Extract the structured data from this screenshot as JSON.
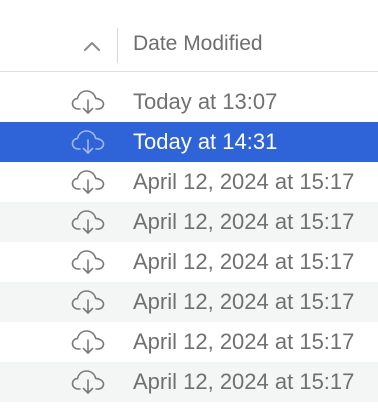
{
  "column": {
    "title": "Date Modified",
    "sort_icon": "chevron-up-icon"
  },
  "rows": [
    {
      "date": "Today at 13:07",
      "icon": "cloud-download-icon",
      "selected": false
    },
    {
      "date": "Today at 14:31",
      "icon": "cloud-download-icon",
      "selected": true
    },
    {
      "date": "April 12, 2024 at 15:17",
      "icon": "cloud-download-icon",
      "selected": false
    },
    {
      "date": "April 12, 2024 at 15:17",
      "icon": "cloud-download-icon",
      "selected": false
    },
    {
      "date": "April 12, 2024 at 15:17",
      "icon": "cloud-download-icon",
      "selected": false
    },
    {
      "date": "April 12, 2024 at 15:17",
      "icon": "cloud-download-icon",
      "selected": false
    },
    {
      "date": "April 12, 2024 at 15:17",
      "icon": "cloud-download-icon",
      "selected": false
    },
    {
      "date": "April 12, 2024 at 15:17",
      "icon": "cloud-download-icon",
      "selected": false
    }
  ],
  "colors": {
    "selection": "#2f63d8",
    "alt_row": "#f4f5f5",
    "text": "#707070",
    "icon": "#7a7a7a",
    "icon_selected": "#9fb9ee"
  }
}
